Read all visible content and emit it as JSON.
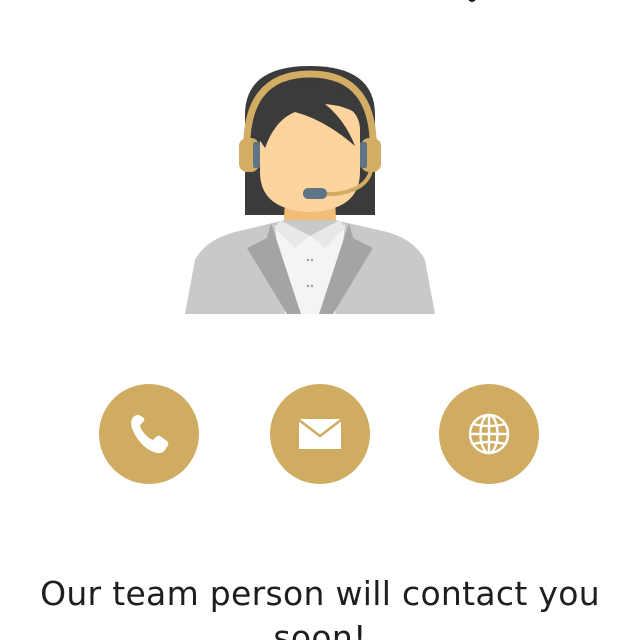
{
  "theme": {
    "accent": "#cfac62",
    "text": "#1e1e1e"
  },
  "illustration": {
    "name": "customer-support-agent",
    "colors": {
      "hair": "#3b3b3b",
      "skin": "#fdd49e",
      "headset": "#d2ad63",
      "mic": "#5e7587",
      "jacket": "#c9c9c9",
      "lapel": "#a4a4a4",
      "shirt": "#f4f4f4"
    }
  },
  "contact_buttons": [
    {
      "icon": "phone-icon"
    },
    {
      "icon": "mail-icon"
    },
    {
      "icon": "globe-icon"
    }
  ],
  "message": "Our team person will contact you soon!"
}
